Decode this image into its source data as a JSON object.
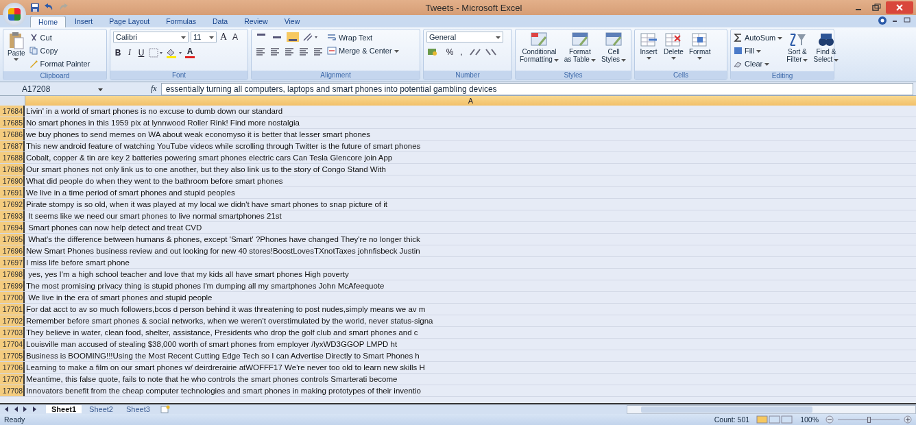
{
  "window": {
    "title": "Tweets - Microsoft Excel"
  },
  "tabs": [
    {
      "label": "Home",
      "selected": true
    },
    {
      "label": "Insert",
      "selected": false
    },
    {
      "label": "Page Layout",
      "selected": false
    },
    {
      "label": "Formulas",
      "selected": false
    },
    {
      "label": "Data",
      "selected": false
    },
    {
      "label": "Review",
      "selected": false
    },
    {
      "label": "View",
      "selected": false
    }
  ],
  "ribbon": {
    "clipboard": {
      "label": "Clipboard",
      "paste": "Paste",
      "items": [
        "Cut",
        "Copy",
        "Format Painter"
      ]
    },
    "font": {
      "label": "Font",
      "font_name": "Calibri",
      "font_size": "11",
      "grow": "A",
      "shrink": "A",
      "bold": "B",
      "italic": "I",
      "underline": "U",
      "font_color": "A"
    },
    "alignment": {
      "label": "Alignment",
      "wrap": "Wrap Text",
      "merge": "Merge & Center"
    },
    "number": {
      "label": "Number",
      "format": "General",
      "percent": "%",
      "comma": ","
    },
    "styles": {
      "label": "Styles",
      "buttons": [
        [
          "Conditional",
          "Formatting"
        ],
        [
          "Format",
          "as Table"
        ],
        [
          "Cell",
          "Styles"
        ]
      ]
    },
    "cells": {
      "label": "Cells",
      "buttons": [
        "Insert",
        "Delete",
        "Format"
      ]
    },
    "editing": {
      "label": "Editing",
      "items": [
        "AutoSum",
        "Fill",
        "Clear"
      ],
      "buttons": [
        [
          "Sort &",
          "Filter"
        ],
        [
          "Find &",
          "Select"
        ]
      ]
    }
  },
  "formula_bar": {
    "name_box": "A17208",
    "fx": "fx",
    "value": "essentially turning all computers, laptops and smart phones into potential gambling devices"
  },
  "sheet": {
    "column": "A",
    "rows": [
      {
        "num": "17684",
        "text": "Livin' in a world of smart phones is no excuse to dumb down our standard"
      },
      {
        "num": "17685",
        "text": "No smart phones in this 1959 pix at lynnwood Roller Rink! Find more nostalgia"
      },
      {
        "num": "17686",
        "text": "we buy phones to send memes on WA about weak economyso it is better that lesser smart phones"
      },
      {
        "num": "17687",
        "text": "This new android feature of watching YouTube videos while scrolling through Twitter is the future of smart phones"
      },
      {
        "num": "17688",
        "text": "Cobalt, copper & tin are key 2 batteries powering smart phones electric cars Can Tesla Glencore join App"
      },
      {
        "num": "17689",
        "text": "Our smart phones not only link us to one another, but they also link us to the story of Congo Stand With"
      },
      {
        "num": "17690",
        "text": "What did people do when they went to the bathroom before smart phones"
      },
      {
        "num": "17691",
        "text": "We live in a time period of smart phones and stupid peoples"
      },
      {
        "num": "17692",
        "text": "Pirate stompy is so old, when it was played at my local we didn't have smart phones to snap picture of it"
      },
      {
        "num": "17693",
        "text": " It seems like we need our smart phones to live normal smartphones 21st"
      },
      {
        "num": "17694",
        "text": " Smart phones can now help detect and treat CVD"
      },
      {
        "num": "17695",
        "text": " What's the difference between humans & phones, except 'Smart' ?Phones have changed They're no longer thick"
      },
      {
        "num": "17696",
        "text": "New Smart Phones business review and out looking for new 40 stores!BoostLovesTXnotTaxes johnfisbeck Justin"
      },
      {
        "num": "17697",
        "text": "I miss life before smart phone"
      },
      {
        "num": "17698",
        "text": " yes, yes I'm a high school teacher and love that my kids all have smart phones High poverty"
      },
      {
        "num": "17699",
        "text": "The most promising privacy thing is stupid phones I'm dumping all my smartphones John McAfeequote"
      },
      {
        "num": "17700",
        "text": " We live in the era of smart phones and stupid people"
      },
      {
        "num": "17701",
        "text": "For dat acct to av so much followers,bcos d person behind it was threatening to post nudes,simply means we av m"
      },
      {
        "num": "17702",
        "text": "Remember before smart phones & social networks, when we weren't overstimulated by the world, never status-signa"
      },
      {
        "num": "17703",
        "text": "They believe in water, clean food, shelter, assistance, Presidents who drop the golf club and smart phones and c"
      },
      {
        "num": "17704",
        "text": "Louisville man accused of stealing $38,000 worth of smart phones from employer /lyxWD3GGOP LMPD ht"
      },
      {
        "num": "17705",
        "text": "Business is BOOMING!!!Using the Most Recent Cutting Edge Tech so I can Advertise Directly to Smart Phones h"
      },
      {
        "num": "17706",
        "text": "Learning to make a film on our smart phones w/ deirdrerairie atWOFFF17 We're never too old to learn new skills H"
      },
      {
        "num": "17707",
        "text": "Meantime, this false quote, fails to note that he who controls the smart phones controls Smarterati become"
      },
      {
        "num": "17708",
        "text": "Innovators benefit from the cheap computer technologies and smart phones in making prototypes of their inventio"
      }
    ]
  },
  "sheet_tabs": [
    {
      "label": "Sheet1",
      "selected": true
    },
    {
      "label": "Sheet2",
      "selected": false
    },
    {
      "label": "Sheet3",
      "selected": false
    }
  ],
  "status_bar": {
    "status": "Ready",
    "count": "Count: 501",
    "zoom": "100%",
    "zoom_slider": {
      "level": 0.5
    }
  }
}
